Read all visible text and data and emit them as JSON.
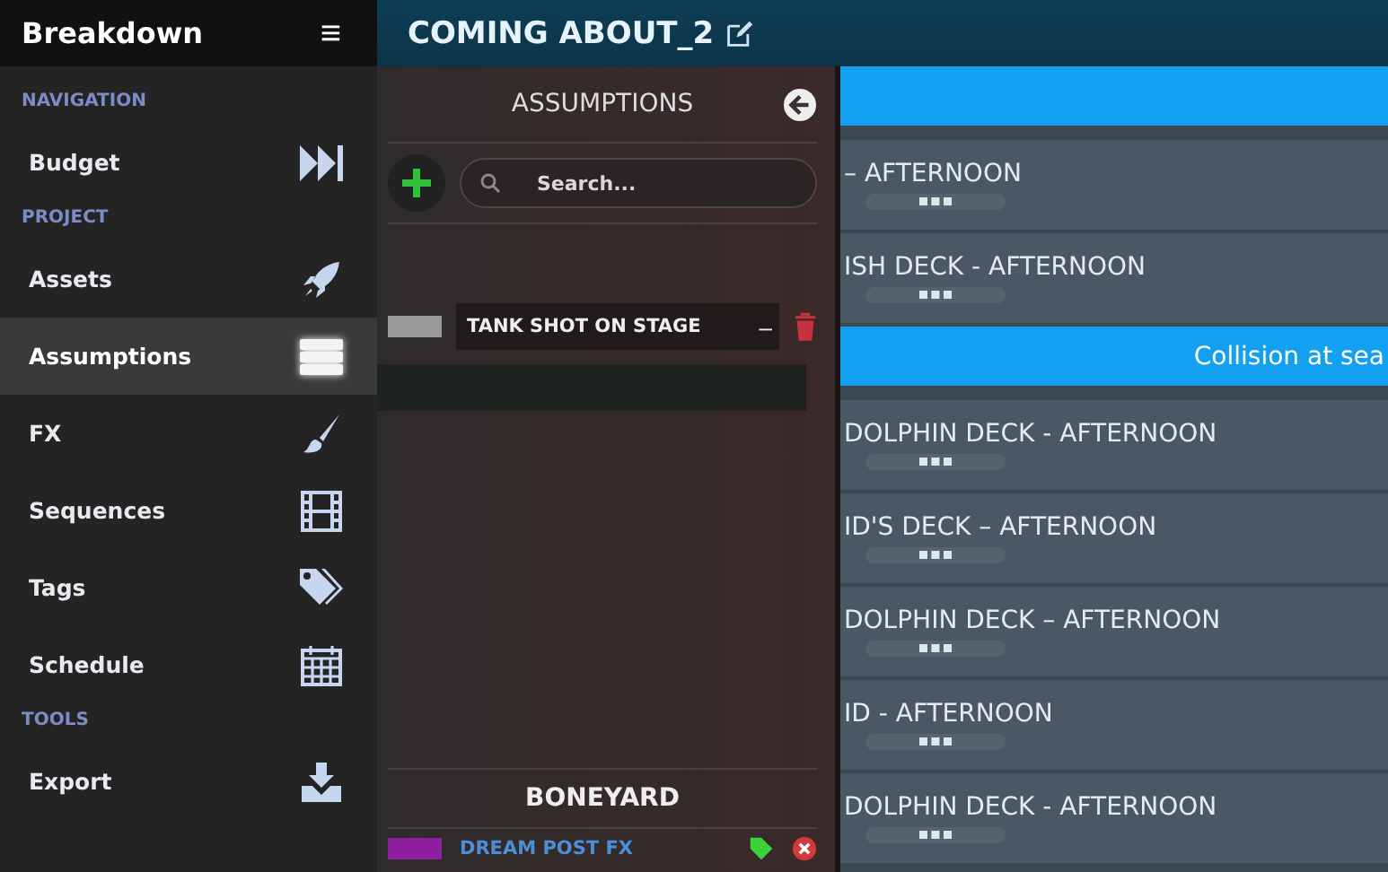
{
  "sidebar": {
    "title": "Breakdown",
    "menu_icon": "≡",
    "sections": [
      {
        "heading": "NAVIGATION",
        "items": [
          {
            "label": "Budget",
            "kind": "skip",
            "selected": false
          }
        ]
      },
      {
        "heading": "PROJECT",
        "items": [
          {
            "label": "Assets",
            "kind": "rocket",
            "selected": false
          },
          {
            "label": "Assumptions",
            "kind": "list",
            "selected": true
          },
          {
            "label": "FX",
            "kind": "brush",
            "selected": false
          },
          {
            "label": "Sequences",
            "kind": "film",
            "selected": false
          },
          {
            "label": "Tags",
            "kind": "tags",
            "selected": false
          },
          {
            "label": "Schedule",
            "kind": "calendar",
            "selected": false
          }
        ]
      },
      {
        "heading": "TOOLS",
        "items": [
          {
            "label": "Export",
            "kind": "download",
            "selected": false
          }
        ]
      }
    ]
  },
  "header": {
    "title": "COMING ABOUT_2"
  },
  "panel": {
    "title": "ASSUMPTIONS",
    "search": {
      "placeholder": "Search..."
    },
    "assumptions": [
      {
        "name": "TANK SHOT ON STAGE",
        "color": "#9a9a9a",
        "collapse": "–"
      }
    ],
    "boneyard": {
      "title": "BONEYARD",
      "items": [
        {
          "name": "DREAM POST FX",
          "color": "#8e1fa0"
        }
      ]
    }
  },
  "rows": [
    {
      "kind": "group",
      "title": ""
    },
    {
      "kind": "scene",
      "title": "– AFTERNOON"
    },
    {
      "kind": "scene",
      "title": "ISH DECK - AFTERNOON"
    },
    {
      "kind": "group",
      "title": "Collision at sea"
    },
    {
      "kind": "scene",
      "title": "DOLPHIN DECK - AFTERNOON"
    },
    {
      "kind": "scene",
      "title": "ID'S DECK – AFTERNOON"
    },
    {
      "kind": "scene",
      "title": "DOLPHIN DECK – AFTERNOON"
    },
    {
      "kind": "scene",
      "title": "ID - AFTERNOON"
    },
    {
      "kind": "scene",
      "title": "DOLPHIN DECK - AFTERNOON"
    }
  ]
}
